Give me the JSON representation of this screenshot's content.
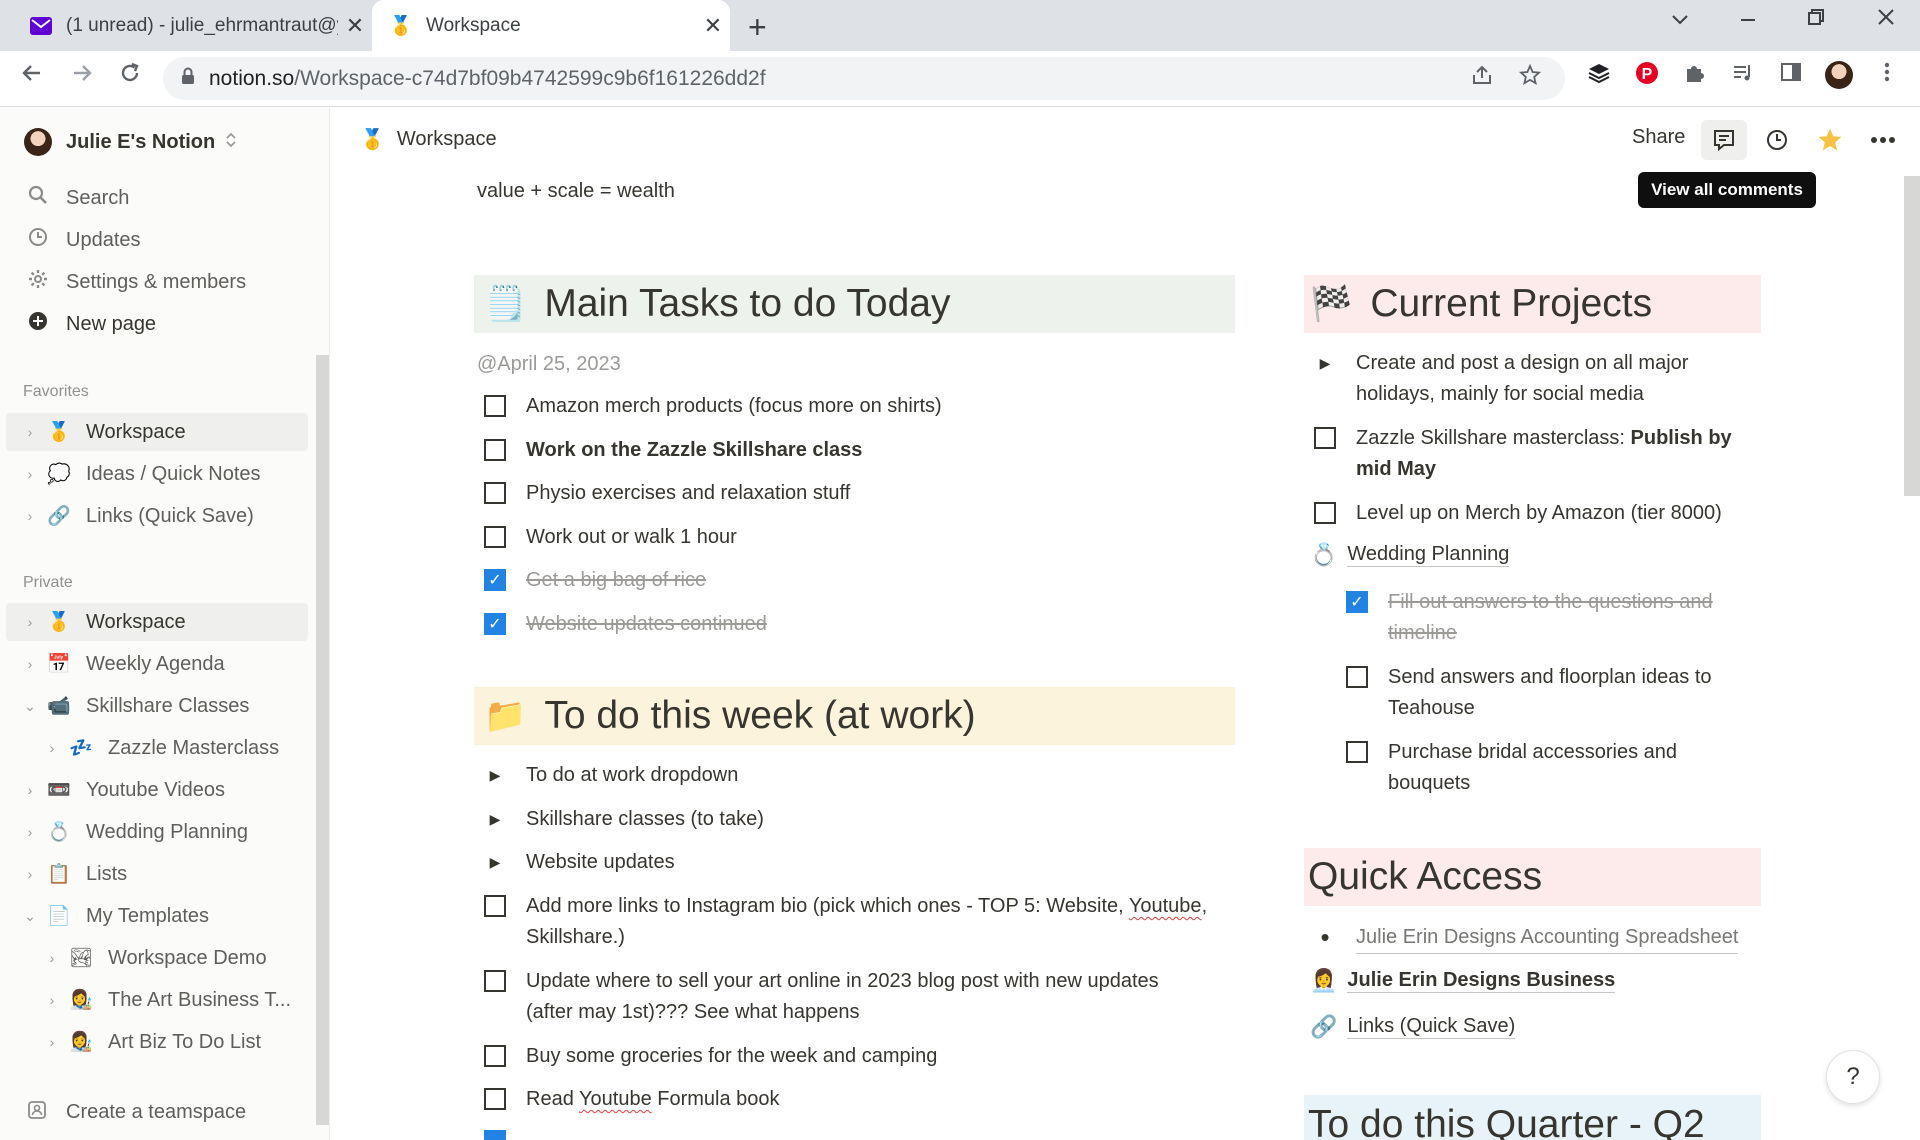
{
  "browser": {
    "tabs": [
      {
        "icon": "envelope",
        "title": "(1 unread) - julie_ehrmantraut@y",
        "close": "✕"
      },
      {
        "icon": "medal",
        "title": "Workspace",
        "close": "✕"
      }
    ],
    "new_tab": "+",
    "url_domain": "notion.so",
    "url_path": "/Workspace-c74d7bf09b4742599c9b6f161226dd2f"
  },
  "sidebar": {
    "workspace_name": "Julie E's Notion",
    "nav": [
      {
        "label": "Search",
        "icon": "search-icon"
      },
      {
        "label": "Updates",
        "icon": "clock-icon"
      },
      {
        "label": "Settings & members",
        "icon": "gear-icon"
      },
      {
        "label": "New page",
        "icon": "plus-circle-icon"
      }
    ],
    "favorites_label": "Favorites",
    "favorites": [
      {
        "emoji": "🥇",
        "label": "Workspace"
      },
      {
        "emoji": "💭",
        "label": "Ideas / Quick Notes"
      },
      {
        "emoji": "🔗",
        "label": "Links (Quick Save)"
      }
    ],
    "private_label": "Private",
    "private": [
      {
        "emoji": "🥇",
        "label": "Workspace",
        "arrow": "›"
      },
      {
        "emoji": "📅",
        "label": "Weekly Agenda",
        "arrow": "›"
      },
      {
        "emoji": "📹",
        "label": "Skillshare Classes",
        "arrow": "⌄"
      },
      {
        "emoji": "💤",
        "label": "Zazzle Masterclass",
        "arrow": "›"
      },
      {
        "emoji": "📼",
        "label": "Youtube Videos",
        "arrow": "›"
      },
      {
        "emoji": "💍",
        "label": "Wedding Planning",
        "arrow": "›"
      },
      {
        "emoji": "📋",
        "label": "Lists",
        "arrow": "›"
      },
      {
        "emoji": "📄",
        "label": "My Templates",
        "arrow": "⌄"
      },
      {
        "emoji": "🏞",
        "label": "Workspace Demo",
        "arrow": "›"
      },
      {
        "emoji": "👩‍🎨",
        "label": "The Art Business T...",
        "arrow": "›"
      },
      {
        "emoji": "👩‍🎨",
        "label": "Art Biz To Do List",
        "arrow": "›"
      }
    ],
    "create_teamspace": "Create a teamspace"
  },
  "topbar": {
    "breadcrumb_emoji": "🥇",
    "breadcrumb": "Workspace",
    "share": "Share",
    "tooltip": "View all comments"
  },
  "page": {
    "motto": "value + scale = wealth",
    "main_tasks": {
      "emoji": "🗒️",
      "title": "Main Tasks to do Today",
      "date": "@April 25, 2023",
      "items": [
        {
          "text": "Amazon merch products (focus more on shirts)",
          "checked": false
        },
        {
          "text": "Work on the Zazzle Skillshare class",
          "checked": false,
          "bold": true
        },
        {
          "text": "Physio exercises and relaxation stuff",
          "checked": false
        },
        {
          "text": "Work out or walk 1 hour",
          "checked": false
        },
        {
          "text": "Get a big bag of rice",
          "checked": true
        },
        {
          "text": "Website updates continued",
          "checked": true
        }
      ]
    },
    "week_work": {
      "emoji": "📁",
      "title": "To do this week (at work)",
      "toggles": [
        "To do at work dropdown",
        "Skillshare classes (to take)",
        "Website updates"
      ],
      "items": [
        {
          "pre": "Add more links to Instagram bio (pick which ones - TOP 5: Website, ",
          "squig": "Youtube",
          "post": ",",
          "line2": "Skillshare.)"
        },
        {
          "line1": "Update where to sell your art online in 2023 blog post with new updates",
          "line2": "(after may 1st)??? See what happens"
        },
        {
          "text": "Buy some groceries for the week and camping"
        },
        {
          "pre": "Read ",
          "squig": "Youtube",
          "post": " Formula book"
        }
      ]
    },
    "current_projects": {
      "emoji": "🏁",
      "title": "Current Projects",
      "toggle": {
        "line1": "Create and post a design on all major",
        "line2": "holidays, mainly for social media"
      },
      "item1": {
        "pre": "Zazzle Skillshare masterclass: ",
        "bold": "Publish by",
        "line2": "mid May"
      },
      "item2": "Level up on Merch by Amazon (tier 8000)",
      "wedding": {
        "emoji": "💍",
        "label": "Wedding Planning"
      },
      "sub": [
        {
          "line1": "Fill out answers to the questions and",
          "line2": "timeline",
          "checked": true
        },
        {
          "line1": "Send answers and floorplan ideas to",
          "line2": "Teahouse",
          "checked": false
        },
        {
          "line1": "Purchase bridal accessories and",
          "line2": "bouquets",
          "checked": false
        }
      ]
    },
    "quick_access": {
      "title": "Quick Access",
      "bullet": "Julie Erin Designs Accounting Spreadsheet",
      "link1": {
        "emoji": "👩‍💼",
        "label": "Julie Erin Designs Business"
      },
      "link2": {
        "emoji": "🔗",
        "label": "Links (Quick Save)"
      }
    },
    "quarter": {
      "title": "To do this Quarter - Q2"
    },
    "check": "✓"
  },
  "colors": {
    "main_tasks_bg": "#edf3ec",
    "week_bg": "#fbf3db",
    "projects_bg": "#fdebec",
    "quick_bg": "#fdebec",
    "quarter_bg": "#e7f3f8",
    "check_blue": "#2383e2"
  },
  "help": "?"
}
